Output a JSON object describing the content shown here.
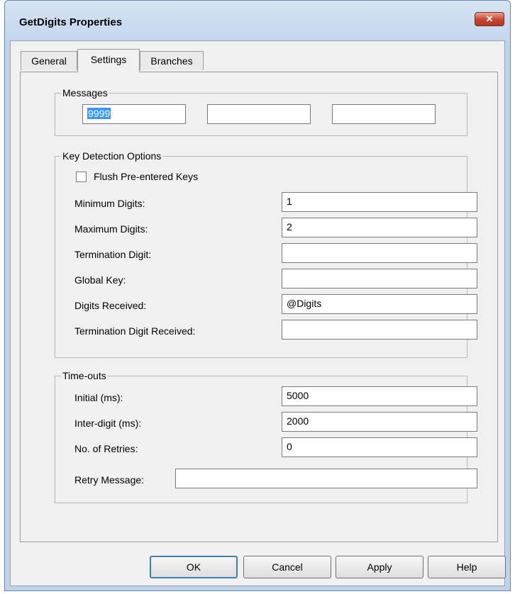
{
  "window": {
    "title": "GetDigits Properties",
    "close_glyph": "✕"
  },
  "tabs": [
    {
      "label": "General"
    },
    {
      "label": "Settings"
    },
    {
      "label": "Branches"
    }
  ],
  "messages": {
    "legend": "Messages",
    "fields": [
      {
        "value": "9999",
        "selected": true
      },
      {
        "value": ""
      },
      {
        "value": ""
      }
    ]
  },
  "key_detection": {
    "legend": "Key Detection Options",
    "flush_label": "Flush Pre-entered Keys",
    "flush_checked": false,
    "rows": [
      {
        "label": "Minimum Digits:",
        "value": "1"
      },
      {
        "label": "Maximum Digits:",
        "value": "2"
      },
      {
        "label": "Termination Digit:",
        "value": ""
      },
      {
        "label": "Global Key:",
        "value": ""
      },
      {
        "label": "Digits Received:",
        "value": "@Digits"
      },
      {
        "label": "Termination Digit Received:",
        "value": ""
      }
    ]
  },
  "timeouts": {
    "legend": "Time-outs",
    "rows": [
      {
        "label": "Initial (ms):",
        "value": "5000"
      },
      {
        "label": "Inter-digit (ms):",
        "value": "2000"
      },
      {
        "label": "No. of Retries:",
        "value": "0"
      }
    ],
    "retry_label": "Retry Message:",
    "retry_value": ""
  },
  "buttons": {
    "ok": "OK",
    "cancel": "Cancel",
    "apply": "Apply",
    "help": "Help"
  }
}
